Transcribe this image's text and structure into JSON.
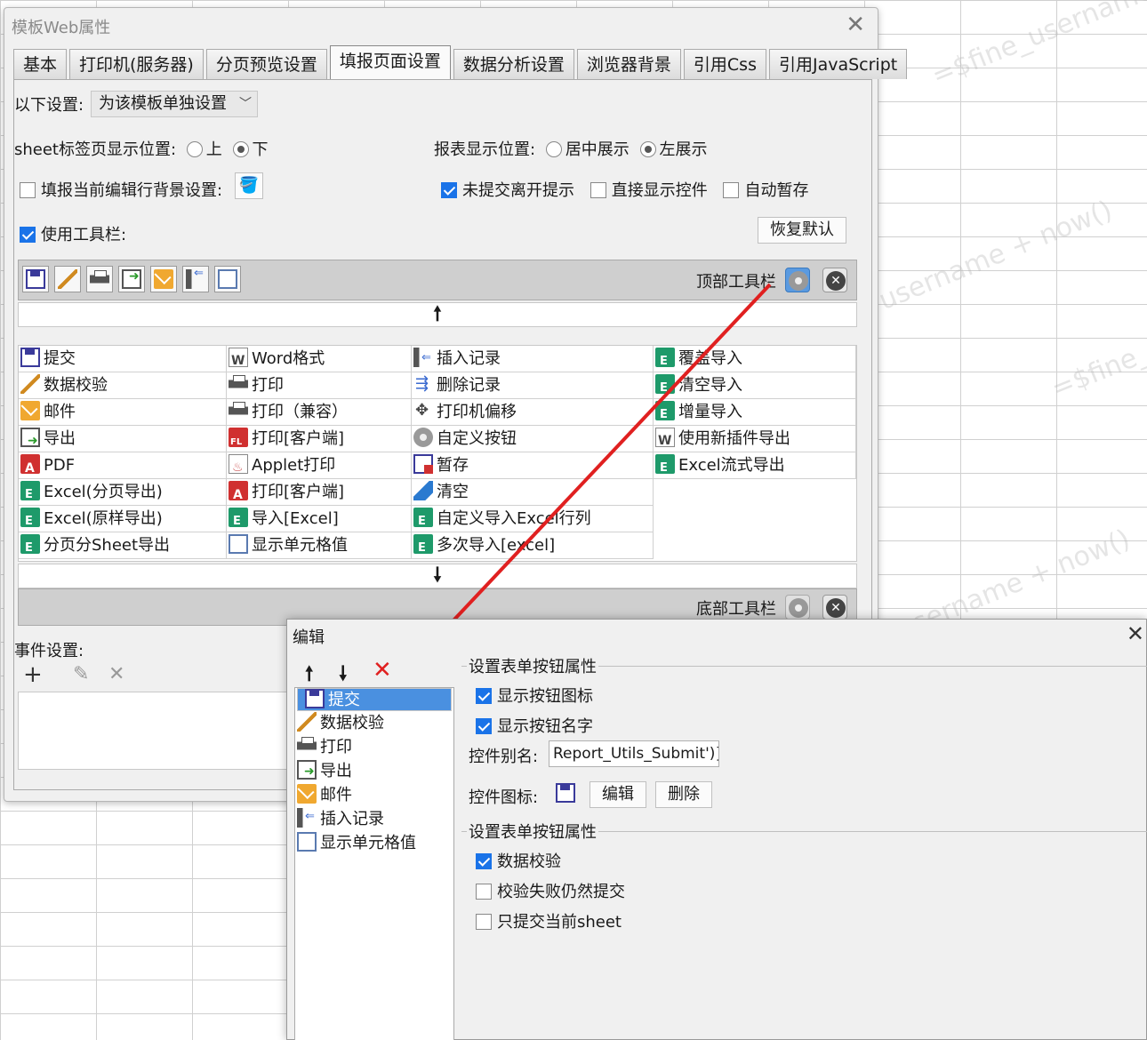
{
  "window": {
    "title": "模板Web属性",
    "close": "✕"
  },
  "tabs": [
    "基本",
    "打印机(服务器)",
    "分页预览设置",
    "填报页面设置",
    "数据分析设置",
    "浏览器背景",
    "引用Css",
    "引用JavaScript"
  ],
  "settings": {
    "scope_label": "以下设置:",
    "scope_value": "为该模板单独设置",
    "sheet_pos_label": "sheet标签页显示位置:",
    "sheet_pos_up": "上",
    "sheet_pos_down": "下",
    "report_pos_label": "报表显示位置:",
    "report_pos_center": "居中展示",
    "report_pos_left": "左展示",
    "fill_bg_label": "填报当前编辑行背景设置:",
    "unsubmitted_label": "未提交离开提示",
    "direct_widget_label": "直接显示控件",
    "autosave_label": "自动暂存",
    "use_toolbar_label": "使用工具栏:",
    "restore_default": "恢复默认"
  },
  "top_toolbar": {
    "label": "顶部工具栏",
    "icons": [
      "save-icon",
      "check-icon",
      "print-icon",
      "export-icon",
      "mail-icon",
      "insert-row-icon",
      "cell-icon"
    ]
  },
  "bottom_toolbar": {
    "label": "底部工具栏"
  },
  "arrows": {
    "up": "🠕",
    "down": "🠗"
  },
  "buttons_grid": {
    "col1": [
      [
        "提交",
        "save"
      ],
      [
        "数据校验",
        "check"
      ],
      [
        "邮件",
        "mail"
      ],
      [
        "导出",
        "export"
      ],
      [
        "PDF",
        "pdf"
      ],
      [
        "Excel(分页导出)",
        "excel"
      ],
      [
        "Excel(原样导出)",
        "excel"
      ],
      [
        "分页分Sheet导出",
        "excel"
      ]
    ],
    "col2": [
      [
        "Word格式",
        "word"
      ],
      [
        "打印",
        "print"
      ],
      [
        "打印（兼容）",
        "print"
      ],
      [
        "打印[客户端]",
        "fl"
      ],
      [
        "Applet打印",
        "applet"
      ],
      [
        "打印[客户端]",
        "pdf"
      ],
      [
        "导入[Excel]",
        "excel"
      ],
      [
        "显示单元格值",
        "cell"
      ]
    ],
    "col3": [
      [
        "插入记录",
        "ins"
      ],
      [
        "删除记录",
        "del"
      ],
      [
        "打印机偏移",
        "move"
      ],
      [
        "自定义按钮",
        "gear"
      ],
      [
        "暂存",
        "tmp"
      ],
      [
        "清空",
        "clear"
      ],
      [
        "自定义导入Excel行列",
        "excel"
      ],
      [
        "多次导入[excel]",
        "excel"
      ]
    ],
    "col4": [
      [
        "覆盖导入",
        "excel"
      ],
      [
        "清空导入",
        "excel"
      ],
      [
        "增量导入",
        "excel"
      ],
      [
        "使用新插件导出",
        "word"
      ],
      [
        "Excel流式导出",
        "excel"
      ]
    ]
  },
  "events": {
    "label": "事件设置:",
    "add": "+",
    "edit": "✎",
    "delete": "✕"
  },
  "edit_dialog": {
    "title": "编辑",
    "close": "✕",
    "up": "🠕",
    "down": "🠗",
    "remove": "✕",
    "list": [
      [
        "提交",
        "save"
      ],
      [
        "数据校验",
        "check"
      ],
      [
        "打印",
        "print"
      ],
      [
        "导出",
        "export"
      ],
      [
        "邮件",
        "mail"
      ],
      [
        "插入记录",
        "ins"
      ],
      [
        "显示单元格值",
        "cell"
      ]
    ],
    "group1_title": "设置表单按钮属性",
    "show_icon": "显示按钮图标",
    "show_name": "显示按钮名字",
    "alias_label": "控件别名:",
    "alias_value": "Report_Utils_Submit')}",
    "icon_label": "控件图标:",
    "edit_btn": "编辑",
    "delete_btn": "删除",
    "group2_title": "设置表单按钮属性",
    "data_check": "数据校验",
    "fail_submit": "校验失败仍然提交",
    "submit_current": "只提交当前sheet"
  }
}
